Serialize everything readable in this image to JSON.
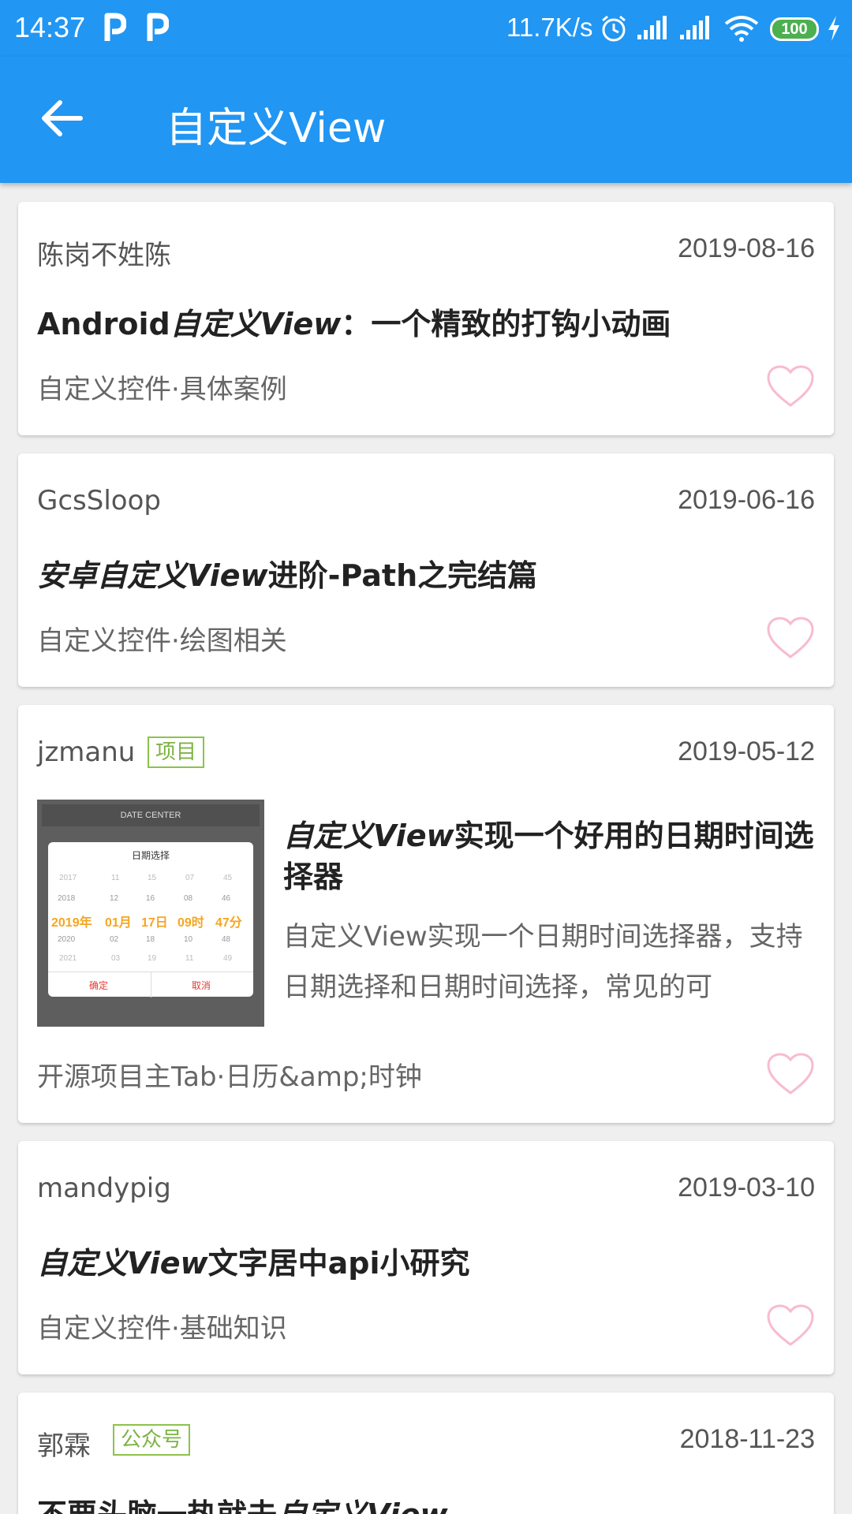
{
  "status_bar": {
    "time": "14:37",
    "net_speed": "11.7K/s",
    "battery": "100"
  },
  "app_bar": {
    "title": "自定义View"
  },
  "articles": [
    {
      "author": "陈岗不姓陈",
      "date": "2019-08-16",
      "title_parts": [
        "Android",
        "自定义View",
        "：一个精致的打钩小动画"
      ],
      "chapter": "自定义控件·具体案例"
    },
    {
      "author": "GcsSloop",
      "date": "2019-06-16",
      "title_parts": [
        "安卓",
        "自定义View",
        "进阶-Path之完结篇"
      ],
      "chapter": "自定义控件·绘图相关"
    },
    {
      "author": "jzmanu",
      "tag": "项目",
      "date": "2019-05-12",
      "title_parts": [
        "自定义View",
        "实现一个好用的日期时间选择器"
      ],
      "desc": "自定义View实现一个日期时间选择器，支持日期选择和日期时间选择，常见的可",
      "chapter": "开源项目主Tab·日历&amp;时钟",
      "thumbnail": {
        "header": "DATE CENTER",
        "dialog_title": "日期选择",
        "rows": [
          [
            "2017",
            "11",
            "15",
            "07",
            "45"
          ],
          [
            "2018",
            "12",
            "16",
            "08",
            "46"
          ],
          [
            "2019年",
            "01月",
            "17日",
            "09时",
            "47分"
          ],
          [
            "2020",
            "02",
            "18",
            "10",
            "48"
          ],
          [
            "2021",
            "03",
            "19",
            "11",
            "49"
          ]
        ],
        "confirm": "确定",
        "cancel": "取消"
      }
    },
    {
      "author": "mandypig",
      "date": "2019-03-10",
      "title_parts": [
        "自定义View",
        "文字居中api小研究"
      ],
      "chapter": "自定义控件·基础知识"
    },
    {
      "author": "郭霖",
      "tag": "公众号",
      "date": "2018-11-23",
      "title_parts": [
        "不要头脑一热就去",
        "自定义View"
      ]
    }
  ],
  "colors": {
    "primary": "#2196f3",
    "tag_green": "#7cb342",
    "heart_outline": "#f8bbd0"
  }
}
